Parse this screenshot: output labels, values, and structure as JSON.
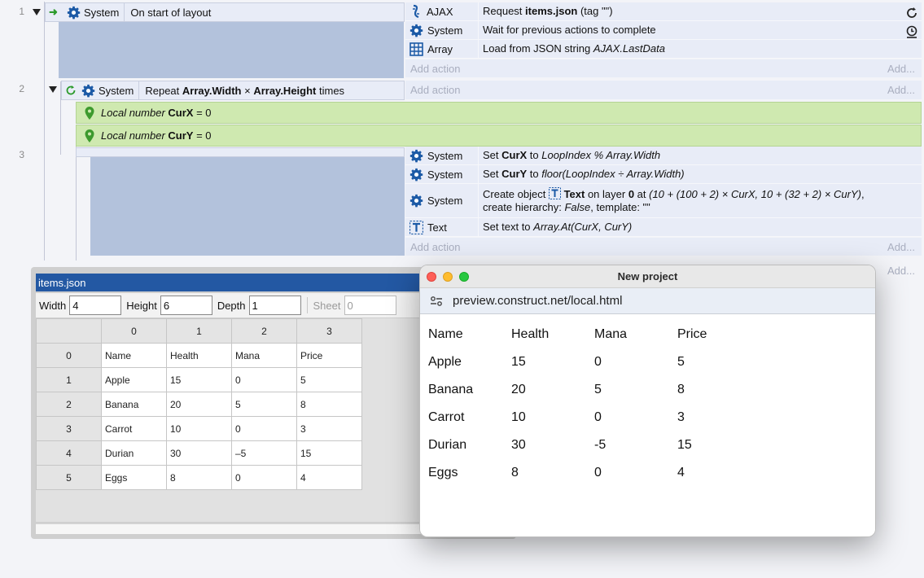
{
  "event_sheet": {
    "rows": [
      {
        "number": "1",
        "condition": {
          "object": "System",
          "text": "On start of layout"
        },
        "actions": [
          {
            "object": "AJAX",
            "icon": "ajax-icon",
            "text_parts": [
              "Request ",
              "items.json",
              " (tag \"\")"
            ]
          },
          {
            "object": "System",
            "icon": "gear-icon",
            "text_parts": [
              "Wait for previous actions to complete"
            ]
          },
          {
            "object": "Array",
            "icon": "array-icon",
            "text_parts": [
              "Load from JSON string ",
              "AJAX.LastData"
            ]
          }
        ]
      },
      {
        "number": "2",
        "condition": {
          "object": "System",
          "text_parts": [
            "Repeat ",
            "Array.Width",
            " × ",
            "Array.Height",
            " times"
          ]
        },
        "locals": [
          {
            "text_parts": [
              "Local number ",
              "CurX",
              " = 0"
            ]
          },
          {
            "text_parts": [
              "Local number ",
              "CurY",
              " = 0"
            ]
          }
        ]
      },
      {
        "number": "3",
        "actions": [
          {
            "object": "System",
            "icon": "gear-icon",
            "text_parts": [
              "Set ",
              "CurX",
              " to ",
              "LoopIndex % Array.Width"
            ]
          },
          {
            "object": "System",
            "icon": "gear-icon",
            "text_parts": [
              "Set ",
              "CurY",
              " to ",
              "floor(LoopIndex ÷ Array.Width)"
            ]
          },
          {
            "object": "System",
            "icon": "gear-icon",
            "text_parts": [
              "Create object ",
              "Text",
              " on layer ",
              "0",
              " at ",
              "(10 + (100 + 2) × CurX, 10 + (32 + 2) × CurY)",
              ",",
              "create hierarchy: ",
              "False",
              ", template: \"\""
            ]
          },
          {
            "object": "Text",
            "icon": "text-object-icon",
            "text_parts": [
              "Set text to ",
              "Array.At(CurX, CurY)"
            ]
          }
        ]
      }
    ],
    "add_action": "Add action",
    "add": "Add..."
  },
  "array_editor": {
    "title": "items.json",
    "width_label": "Width",
    "width_value": "4",
    "height_label": "Height",
    "height_value": "6",
    "depth_label": "Depth",
    "depth_value": "1",
    "sheet_label": "Sheet",
    "sheet_value": "0",
    "column_headers": [
      "0",
      "1",
      "2",
      "3"
    ],
    "row_headers": [
      "0",
      "1",
      "2",
      "3",
      "4",
      "5"
    ],
    "cells": [
      [
        "Name",
        "Health",
        "Mana",
        "Price"
      ],
      [
        "Apple",
        "15",
        "0",
        "5"
      ],
      [
        "Banana",
        "20",
        "5",
        "8"
      ],
      [
        "Carrot",
        "10",
        "0",
        "3"
      ],
      [
        "Durian",
        "30",
        "–5",
        "15"
      ],
      [
        "Eggs",
        "8",
        "0",
        "4"
      ]
    ]
  },
  "browser": {
    "title": "New project",
    "url": "preview.construct.net/local.html",
    "table": [
      [
        "Name",
        "Health",
        "Mana",
        "Price"
      ],
      [
        "Apple",
        "15",
        "0",
        "5"
      ],
      [
        "Banana",
        "20",
        "5",
        "8"
      ],
      [
        "Carrot",
        "10",
        "0",
        "3"
      ],
      [
        "Durian",
        "30",
        "-5",
        "15"
      ],
      [
        "Eggs",
        "8",
        "0",
        "4"
      ]
    ]
  },
  "colors": {
    "event_block": "#b3c2dc",
    "action_row": "#e8ecf7",
    "local_var": "#cfe9b0",
    "array_title": "#2358a3"
  }
}
